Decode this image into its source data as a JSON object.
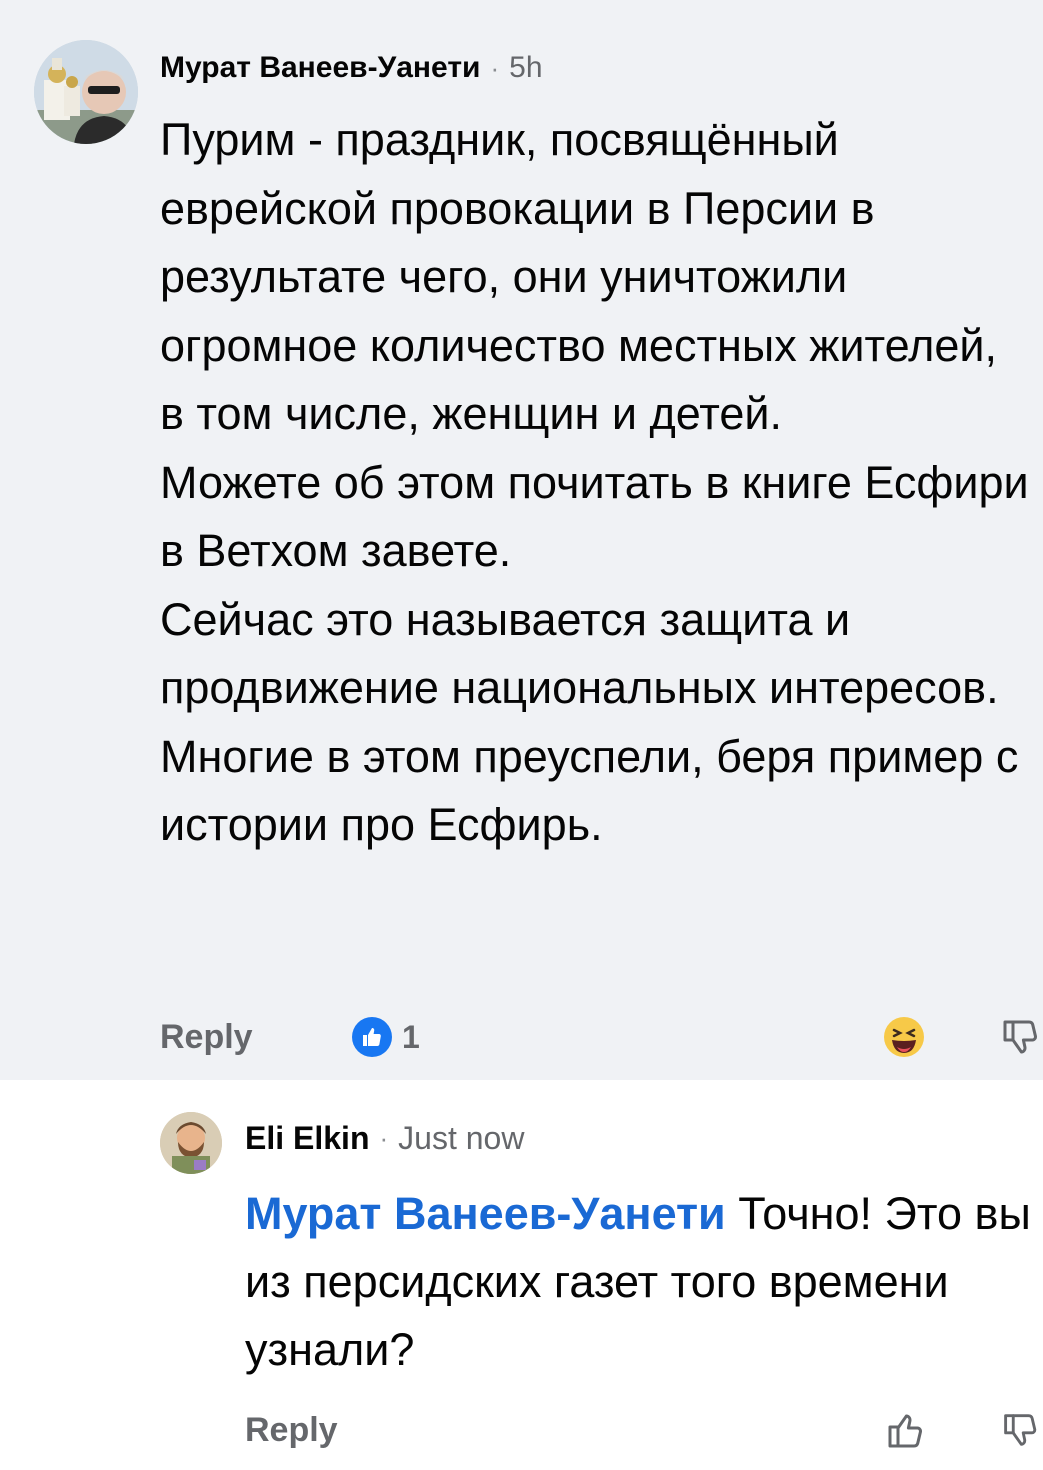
{
  "comments": [
    {
      "author": "Мурат Ванеев-Уанети",
      "separator": "·",
      "time": "5h",
      "body_lines": [
        "Пурим - праздник, посвящённый еврейской провокации в Персии в результате чего, они уничтожили огромное количество местных жителей, в том числе, женщин и детей.",
        "Можете об этом почитать в книге Есфири в Ветхом завете.",
        "Сейчас это называется защита и продвижение национальных интересов.",
        "Многие в этом преуспели, беря пример с истории про Есфирь."
      ],
      "reply_label": "Reply",
      "reaction_count": "1",
      "icons": {
        "reaction": "like-reaction-icon",
        "haha": "haha-reaction-icon",
        "dislike": "thumbs-down-icon"
      }
    },
    {
      "author": "Eli Elkin",
      "separator": "·",
      "time": "Just now",
      "mention": "Мурат Ванеев-Уанети",
      "body": " Точно! Это вы из персидских газет того времени узнали?",
      "reply_label": "Reply",
      "icons": {
        "like": "thumbs-up-icon",
        "dislike": "thumbs-down-icon"
      }
    }
  ],
  "colors": {
    "highlight_background": "#f0f2f5",
    "mention": "#1a69d4",
    "like_blue": "#1877f2",
    "secondary_text": "#65676b"
  }
}
